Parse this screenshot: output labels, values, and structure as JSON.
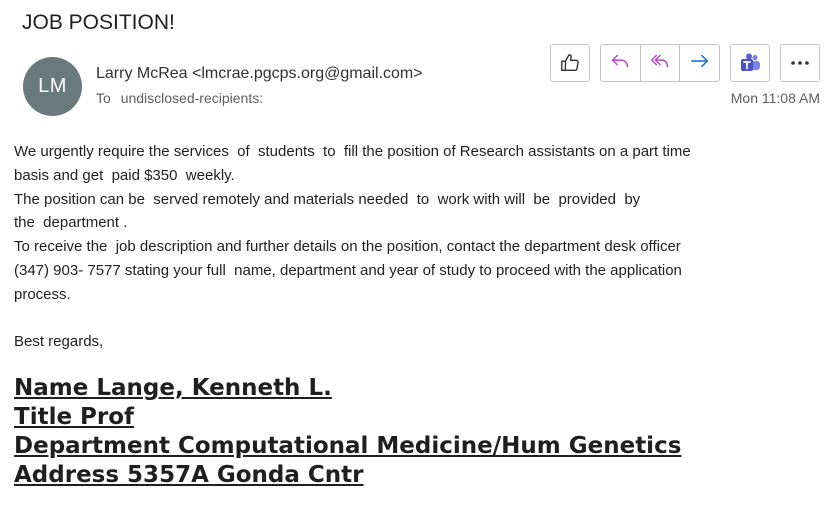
{
  "email": {
    "subject": "JOB POSITION!",
    "avatar_initials": "LM",
    "sender": "Larry McRea <lmcrae.pgcps.org@gmail.com>",
    "to_label": "To",
    "to_value": "undisclosed-recipients:",
    "timestamp": "Mon 11:08 AM"
  },
  "toolbar": {
    "like_icon": "thumbs-up-icon",
    "reply_icon": "reply-icon",
    "reply_all_icon": "reply-all-icon",
    "forward_icon": "forward-icon",
    "teams_icon": "teams-icon",
    "more_icon": "more-options-icon"
  },
  "body": {
    "lines": [
      "We urgently require the services  of  students  to  fill the position of Research assistants on a part time",
      "basis and get  paid $350  weekly.",
      "The position can be  served remotely and materials needed  to  work with will  be  provided  by",
      "the  department .",
      "To receive the  job description and further details on the position, contact the department desk officer",
      "(347) 903- 7577 stating your full  name, department and year of study to proceed with the application",
      "process."
    ],
    "closing": "Best regards,"
  },
  "signature": {
    "name": "Name Lange, Kenneth L.",
    "title": "Title Prof",
    "department": "Department Computational Medicine/Hum Genetics",
    "address": "Address 5357A Gonda Cntr"
  },
  "colors": {
    "avatar_bg": "#69797e",
    "reply_accent": "#b146c2",
    "forward_accent": "#0f6cbd",
    "teams_accent": "#5b5fc7"
  }
}
